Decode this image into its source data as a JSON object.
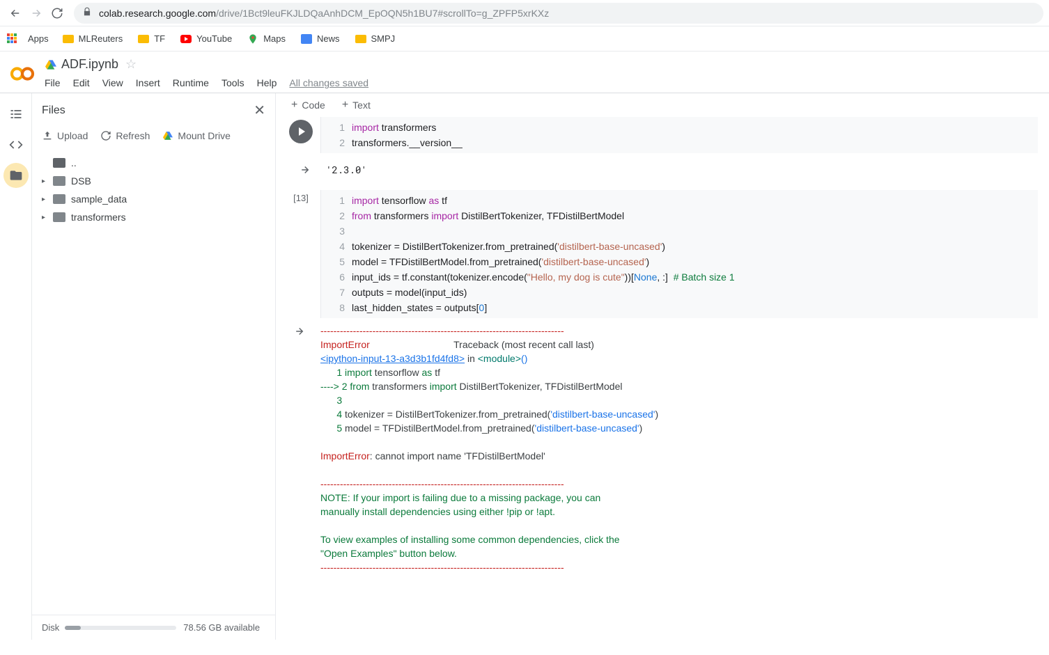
{
  "browser": {
    "url_domain": "colab.research.google.com",
    "url_path": "/drive/1Bct9leuFKJLDQaAnhDCM_EpOQN5h1BU7#scrollTo=g_ZPFP5xrKXz"
  },
  "bookmarks": {
    "apps": "Apps",
    "items": [
      "MLReuters",
      "TF",
      "YouTube",
      "Maps",
      "News",
      "SMPJ"
    ]
  },
  "notebook": {
    "title": "ADF.ipynb",
    "menus": [
      "File",
      "Edit",
      "View",
      "Insert",
      "Runtime",
      "Tools",
      "Help"
    ],
    "changes": "All changes saved",
    "add_code": "Code",
    "add_text": "Text"
  },
  "files_panel": {
    "title": "Files",
    "upload": "Upload",
    "refresh": "Refresh",
    "mount": "Mount Drive",
    "up": "..",
    "items": [
      "DSB",
      "sample_data",
      "transformers"
    ]
  },
  "disk": {
    "label": "Disk",
    "available": "78.56 GB available"
  },
  "cell1": {
    "line1_kw": "import",
    "line1_rest": " transformers",
    "line2": "transformers.__version__",
    "output": "'2.3.0'"
  },
  "cell2": {
    "prompt": "[13]",
    "l1": {
      "a": "import",
      "b": " tensorflow ",
      "c": "as",
      "d": " tf"
    },
    "l2": {
      "a": "from",
      "b": " transformers ",
      "c": "import",
      "d": " DistilBertTokenizer, TFDistilBertModel"
    },
    "l4": {
      "a": "tokenizer = DistilBertTokenizer.from_pretrained(",
      "s": "'distilbert-base-uncased'",
      "b": ")"
    },
    "l5": {
      "a": "model = TFDistilBertModel.from_pretrained(",
      "s": "'distilbert-base-uncased'",
      "b": ")"
    },
    "l6": {
      "a": "input_ids = tf.constant(tokenizer.encode(",
      "s": "\"Hello, my dog is cute\"",
      "b": "))[",
      "n": "None",
      "c": ", :]  ",
      "com": "# Batch size 1"
    },
    "l7": "outputs = model(input_ids)",
    "l8": {
      "a": "last_hidden_states = outputs[",
      "n": "0",
      "b": "]"
    }
  },
  "traceback": {
    "dash": "---------------------------------------------------------------------------",
    "err": "ImportError",
    "tb_label": "                               Traceback (most recent call last)",
    "link": "<ipython-input-13-a3d3b1fd4fd8>",
    "in_txt": " in ",
    "module": "<module>",
    "paren": "()",
    "l1": {
      "n": "      1 ",
      "a": "import",
      "b": " tensorflow ",
      "c": "as",
      "d": " tf"
    },
    "l2": {
      "arrow": "----> 2 ",
      "a": "from",
      "b": " transformers ",
      "c": "import",
      "d": " DistilBertTokenizer",
      "e": ",",
      "f": " TFDistilBertModel"
    },
    "l3": "      3 ",
    "l4": {
      "n": "      4 ",
      "a": "tokenizer ",
      "eq": "=",
      "b": " DistilBertTokenizer",
      "dot": ".",
      "c": "from_pretrained",
      "p1": "(",
      "s": "'distilbert-base-uncased'",
      "p2": ")"
    },
    "l5": {
      "n": "      5 ",
      "a": "model ",
      "eq": "=",
      "b": " TFDistilBertModel",
      "dot": ".",
      "c": "from_pretrained",
      "p1": "(",
      "s": "'distilbert-base-uncased'",
      "p2": ")"
    },
    "err2": "ImportError",
    "msg": ": cannot import name 'TFDistilBertModel'",
    "note1": "NOTE: If your import is failing due to a missing package, you can",
    "note2": "manually install dependencies using either !pip or !apt.",
    "note3": "To view examples of installing some common dependencies, click the",
    "note4": "\"Open Examples\" button below.",
    "dash2": "---------------------------------------------------------------------------"
  }
}
